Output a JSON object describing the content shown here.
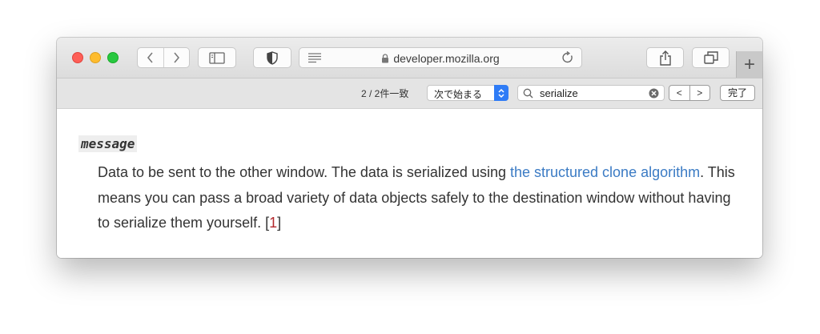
{
  "browser": {
    "url": "developer.mozilla.org",
    "new_tab_label": "+"
  },
  "find": {
    "count": "2 / 2件一致",
    "mode": "次で始まる",
    "query": "serialize",
    "prev": "<",
    "next": ">",
    "done": "完了"
  },
  "content": {
    "term": "message",
    "desc_1": "Data to be sent to the other window. The data is serialized using ",
    "link": "the structured clone algorithm",
    "desc_2": ". This means you can pass a broad variety of data objects safely to the destination window without having to serialize them yourself. [",
    "footnote": "1",
    "desc_3": "]"
  },
  "colors": {
    "link": "#3b7bc4",
    "footnote": "#b3282d",
    "accent": "#2f7cf6"
  }
}
